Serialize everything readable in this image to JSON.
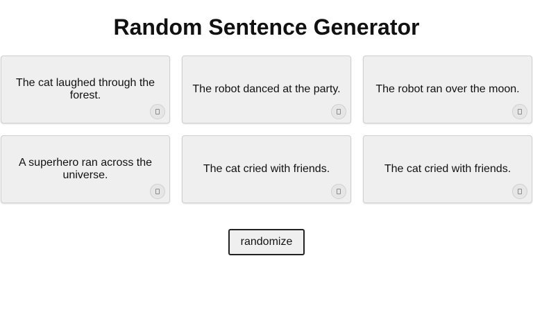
{
  "page": {
    "title": "Random Sentence Generator"
  },
  "cards": [
    {
      "text": "The cat laughed through the forest.",
      "icon": "copy-icon"
    },
    {
      "text": "The robot danced at the party.",
      "icon": "copy-icon"
    },
    {
      "text": "The robot ran over the moon.",
      "icon": "copy-icon"
    },
    {
      "text": "A superhero ran across the universe.",
      "icon": "copy-icon"
    },
    {
      "text": "The cat cried with friends.",
      "icon": "copy-icon"
    },
    {
      "text": "The cat cried with friends.",
      "icon": "copy-icon"
    }
  ],
  "controls": {
    "randomize_label": "randomize"
  }
}
